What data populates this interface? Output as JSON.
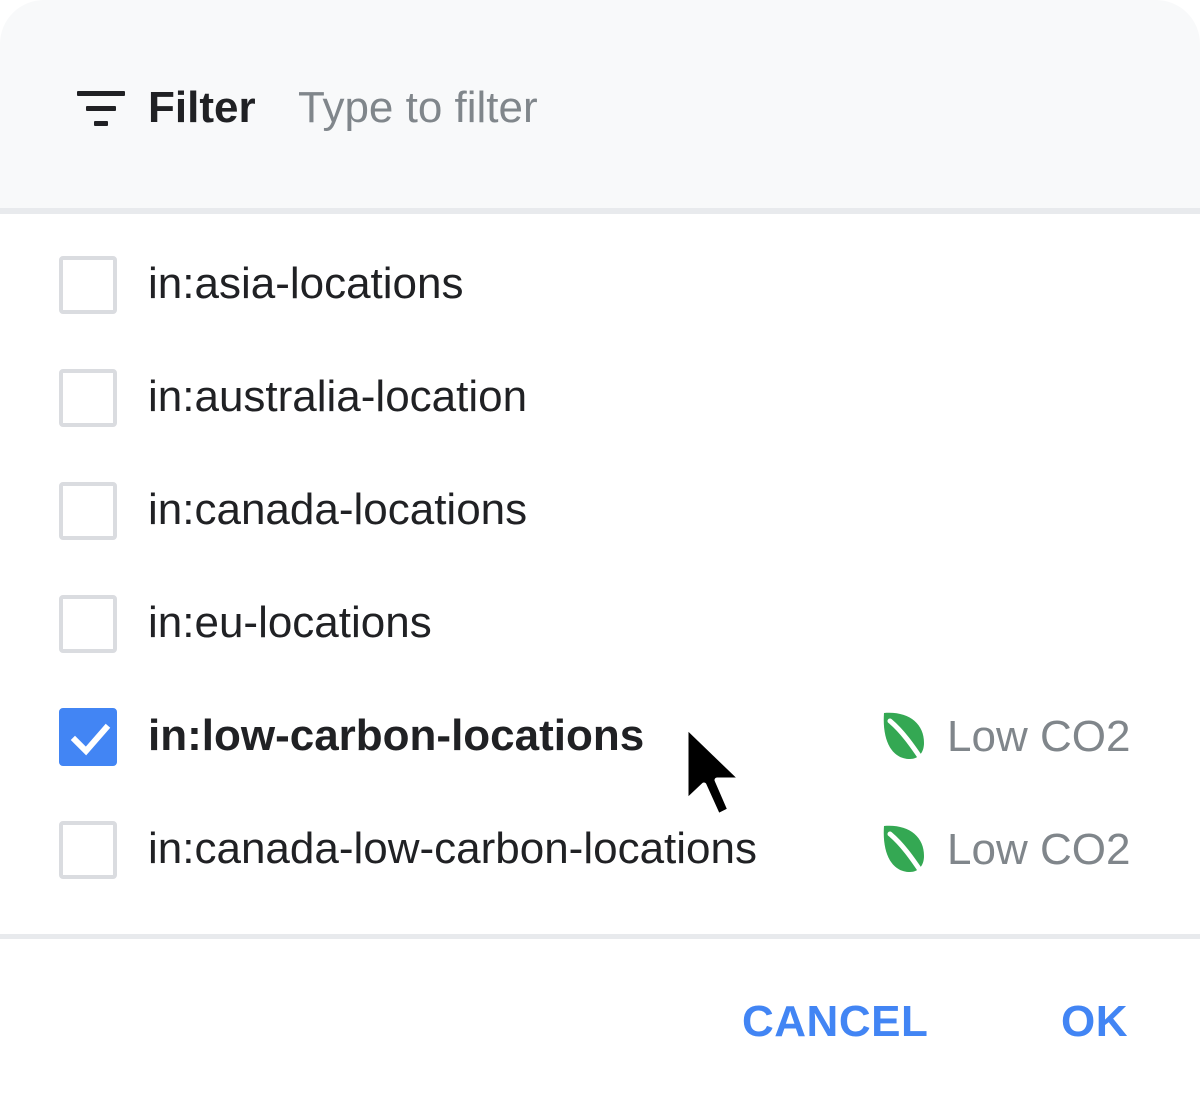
{
  "filter": {
    "label": "Filter",
    "placeholder": "Type to filter",
    "icon": "filter-list-icon"
  },
  "options": [
    {
      "label": "in:asia-locations",
      "checked": false
    },
    {
      "label": "in:australia-location",
      "checked": false
    },
    {
      "label": "in:canada-locations",
      "checked": false
    },
    {
      "label": "in:eu-locations",
      "checked": false
    },
    {
      "label": "in:low-carbon-locations",
      "checked": true,
      "badge": "Low CO2",
      "badge_icon": "leaf-icon"
    },
    {
      "label": "in:canada-low-carbon-locations",
      "checked": false,
      "badge": "Low CO2",
      "badge_icon": "leaf-icon"
    }
  ],
  "actions": {
    "cancel": "CANCEL",
    "ok": "OK"
  },
  "colors": {
    "accent": "#4285f4",
    "leaf": "#34a853",
    "header_bg": "#f8f9fa",
    "text": "#202124",
    "muted": "#80868b",
    "border": "#dadce0"
  }
}
